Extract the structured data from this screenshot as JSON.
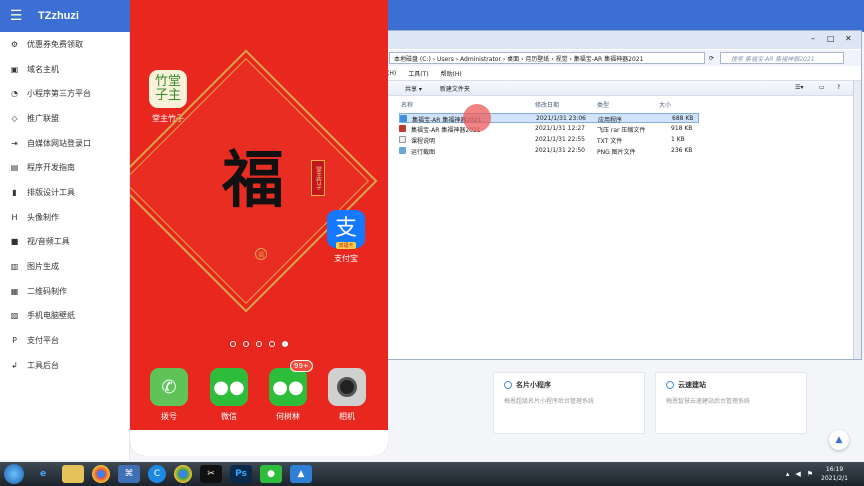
{
  "app": {
    "title": "TZzhuzi"
  },
  "sidebar": {
    "items": [
      {
        "icon": "gear-icon",
        "label": "优惠券免费领取"
      },
      {
        "icon": "server-icon",
        "label": "域名主机"
      },
      {
        "icon": "miniprogram-icon",
        "label": "小程序第三方平台"
      },
      {
        "icon": "diamond-icon",
        "label": "推广联盟"
      },
      {
        "icon": "login-icon",
        "label": "自媒体网站登录口"
      },
      {
        "icon": "doc-icon",
        "label": "程序开发指南"
      },
      {
        "icon": "bookmark-icon",
        "label": "排版设计工具"
      },
      {
        "icon": "h-icon",
        "label": "头像制作"
      },
      {
        "icon": "video-icon",
        "label": "视/音频工具"
      },
      {
        "icon": "image-icon",
        "label": "图片生成"
      },
      {
        "icon": "qrcode-icon",
        "label": "二维码制作"
      },
      {
        "icon": "wallpaper-icon",
        "label": "手机电脑壁纸"
      },
      {
        "icon": "pay-icon",
        "label": "支付平台"
      },
      {
        "icon": "backend-icon",
        "label": "工具后台"
      }
    ]
  },
  "cards": [
    {
      "title": "名片小程序",
      "desc": "梅恩超级名片小程序后台管理系统"
    },
    {
      "title": "云速建站",
      "desc": "梅恩智慧云速建站后台管理系统"
    }
  ],
  "explorer": {
    "address": "本地磁盘 (C:) › Users › Administrator › 桌面 › 月历壁纸 › 视觉 › 集福宝-AR 集福神器2021",
    "search_placeholder": "搜索 集福宝-AR 集福神器2021",
    "menu": [
      "(H)",
      "工具(T)",
      "帮助(H)"
    ],
    "commands": [
      "共享 ▾",
      "新建文件夹"
    ],
    "columns": [
      "名称",
      "修改日期",
      "类型",
      "大小"
    ],
    "files": [
      {
        "name": "集福宝-AR 集福神器2021",
        "date": "2021/1/31 23:06",
        "type": "应用程序",
        "size": "688 KB",
        "color": "#3d8ee0"
      },
      {
        "name": "集福宝-AR 集福神器2021",
        "date": "2021/1/31 12:27",
        "type": "飞压 rar 压缩文件",
        "size": "918 KB",
        "color": "#c0392b"
      },
      {
        "name": "课程说明",
        "date": "2021/1/31 22:55",
        "type": "TXT 文件",
        "size": "1 KB",
        "color": "#eeeeee"
      },
      {
        "name": "运行截图",
        "date": "2021/1/31 22:50",
        "type": "PNG 图片文件",
        "size": "236 KB",
        "color": "#6aa6d8"
      }
    ]
  },
  "phone": {
    "apps": {
      "zhuzi": {
        "label": "堂主竹子",
        "icon_text": "竹堂\n子主"
      },
      "alipay": {
        "label": "支付宝",
        "icon_text": "支",
        "sub": "双福卡"
      },
      "fu_char": "福",
      "fu_seal": "堂主竹子",
      "fu_logo": "福",
      "dock": [
        {
          "label": "拨号",
          "icon": "phone-icon",
          "color": "#5fc35a"
        },
        {
          "label": "微信",
          "icon": "wechat-icon",
          "color": "#2dbd3b"
        },
        {
          "label": "何树林",
          "icon": "wechat-icon",
          "color": "#2dbd3b"
        },
        {
          "label": "相机",
          "icon": "camera-icon",
          "color": "#d0d0d0"
        }
      ],
      "badge": "99+"
    },
    "page_count": 5,
    "active_page": 5
  },
  "taskbar": {
    "apps": [
      "ie-icon",
      "folder-icon",
      "chrome-icon",
      "app-icon",
      "edge-icon",
      "chrome2-icon",
      "capcut-icon",
      "photoshop-icon",
      "wechat-icon",
      "tool-icon"
    ],
    "time": "16:19",
    "date": "2021/2/1"
  }
}
